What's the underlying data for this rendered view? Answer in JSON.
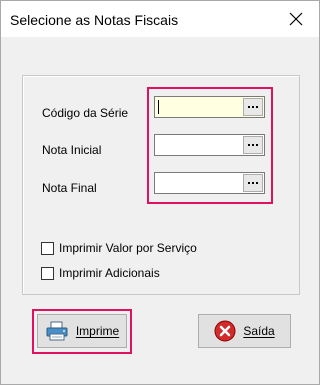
{
  "window": {
    "title": "Selecione as Notas Fiscais"
  },
  "fields": [
    {
      "label": "Código da Série",
      "value": ""
    },
    {
      "label": "Nota Inicial",
      "value": ""
    },
    {
      "label": "Nota Final",
      "value": ""
    }
  ],
  "options": [
    {
      "label": "Imprimir Valor por Serviço",
      "checked": false
    },
    {
      "label": "Imprimir Adicionais",
      "checked": false
    }
  ],
  "buttons": {
    "print_label": "Imprime",
    "exit_label": "Saída"
  },
  "colors": {
    "highlight": "#e0115f",
    "focused_field_bg": "#ffffe1"
  }
}
